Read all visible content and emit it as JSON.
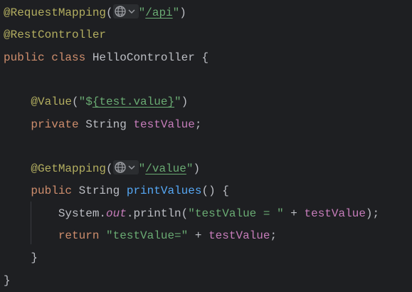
{
  "colors": {
    "background": "#1e1f22",
    "annotation": "#b3ae60",
    "keyword": "#cf8e6d",
    "string": "#6aab73",
    "field": "#c77dbb",
    "method": "#56a8f5",
    "text": "#bcbec4"
  },
  "lines": [
    [
      {
        "t": "annotation",
        "v": "@RequestMapping"
      },
      {
        "t": "plain",
        "v": "("
      },
      {
        "t": "inlay",
        "icon": "globe-icon"
      },
      {
        "t": "string",
        "v": "\""
      },
      {
        "t": "url",
        "v": "/api"
      },
      {
        "t": "string",
        "v": "\""
      },
      {
        "t": "plain",
        "v": ")"
      }
    ],
    [
      {
        "t": "annotation",
        "v": "@RestController"
      }
    ],
    [
      {
        "t": "keyword",
        "v": "public class "
      },
      {
        "t": "plain",
        "v": "HelloController {"
      }
    ],
    [],
    [
      {
        "t": "plain",
        "v": "    "
      },
      {
        "t": "annotation",
        "v": "@Value"
      },
      {
        "t": "plain",
        "v": "("
      },
      {
        "t": "string",
        "v": "\"$"
      },
      {
        "t": "url",
        "v": "{test.value}"
      },
      {
        "t": "string",
        "v": "\""
      },
      {
        "t": "plain",
        "v": ")"
      }
    ],
    [
      {
        "t": "plain",
        "v": "    "
      },
      {
        "t": "keyword",
        "v": "private "
      },
      {
        "t": "plain",
        "v": "String "
      },
      {
        "t": "field",
        "v": "testValue"
      },
      {
        "t": "plain",
        "v": ";"
      }
    ],
    [],
    [
      {
        "t": "plain",
        "v": "    "
      },
      {
        "t": "annotation",
        "v": "@GetMapping"
      },
      {
        "t": "plain",
        "v": "("
      },
      {
        "t": "inlay",
        "icon": "globe-icon"
      },
      {
        "t": "string",
        "v": "\""
      },
      {
        "t": "url",
        "v": "/value"
      },
      {
        "t": "string",
        "v": "\""
      },
      {
        "t": "plain",
        "v": ")"
      }
    ],
    [
      {
        "t": "plain",
        "v": "    "
      },
      {
        "t": "keyword",
        "v": "public "
      },
      {
        "t": "plain",
        "v": "String "
      },
      {
        "t": "method",
        "v": "printValues"
      },
      {
        "t": "plain",
        "v": "() {"
      }
    ],
    [
      {
        "t": "plain",
        "v": "        System."
      },
      {
        "t": "static-field",
        "v": "out"
      },
      {
        "t": "plain",
        "v": ".println("
      },
      {
        "t": "string",
        "v": "\"testValue = \""
      },
      {
        "t": "plain",
        "v": " + "
      },
      {
        "t": "field",
        "v": "testValue"
      },
      {
        "t": "plain",
        "v": ");"
      }
    ],
    [
      {
        "t": "plain",
        "v": "        "
      },
      {
        "t": "keyword",
        "v": "return "
      },
      {
        "t": "string",
        "v": "\"testValue=\""
      },
      {
        "t": "plain",
        "v": " + "
      },
      {
        "t": "field",
        "v": "testValue"
      },
      {
        "t": "plain",
        "v": ";"
      }
    ],
    [
      {
        "t": "plain",
        "v": "    }"
      }
    ],
    [
      {
        "t": "plain",
        "v": "}"
      }
    ]
  ]
}
